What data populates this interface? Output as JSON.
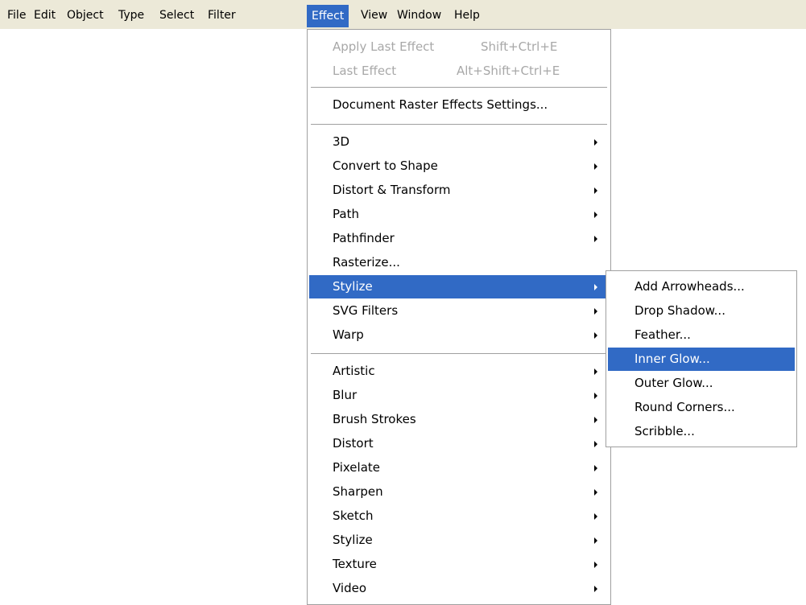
{
  "menubar": {
    "items": [
      "File",
      "Edit",
      "Object",
      "Type",
      "Select",
      "Filter",
      "Effect",
      "View",
      "Window",
      "Help"
    ],
    "active": "Effect"
  },
  "effect_menu": {
    "apply_last_effect": {
      "label": "Apply Last Effect",
      "shortcut": "Shift+Ctrl+E",
      "enabled": false
    },
    "last_effect": {
      "label": "Last Effect",
      "shortcut": "Alt+Shift+Ctrl+E",
      "enabled": false
    },
    "document_raster": "Document Raster Effects Settings...",
    "illustrator_effects": [
      "3D",
      "Convert to Shape",
      "Distort & Transform",
      "Path",
      "Pathfinder",
      "Rasterize...",
      "Stylize",
      "SVG Filters",
      "Warp"
    ],
    "photoshop_effects": [
      "Artistic",
      "Blur",
      "Brush Strokes",
      "Distort",
      "Pixelate",
      "Sharpen",
      "Sketch",
      "Stylize",
      "Texture",
      "Video"
    ],
    "highlighted": "Stylize"
  },
  "stylize_submenu": {
    "items": [
      "Add Arrowheads...",
      "Drop Shadow...",
      "Feather...",
      "Inner Glow...",
      "Outer Glow...",
      "Round Corners...",
      "Scribble..."
    ],
    "highlighted": "Inner Glow..."
  },
  "colors": {
    "menubar_bg": "#ece9d8",
    "highlight": "#316ac5",
    "disabled_text": "#a8a8a8"
  }
}
